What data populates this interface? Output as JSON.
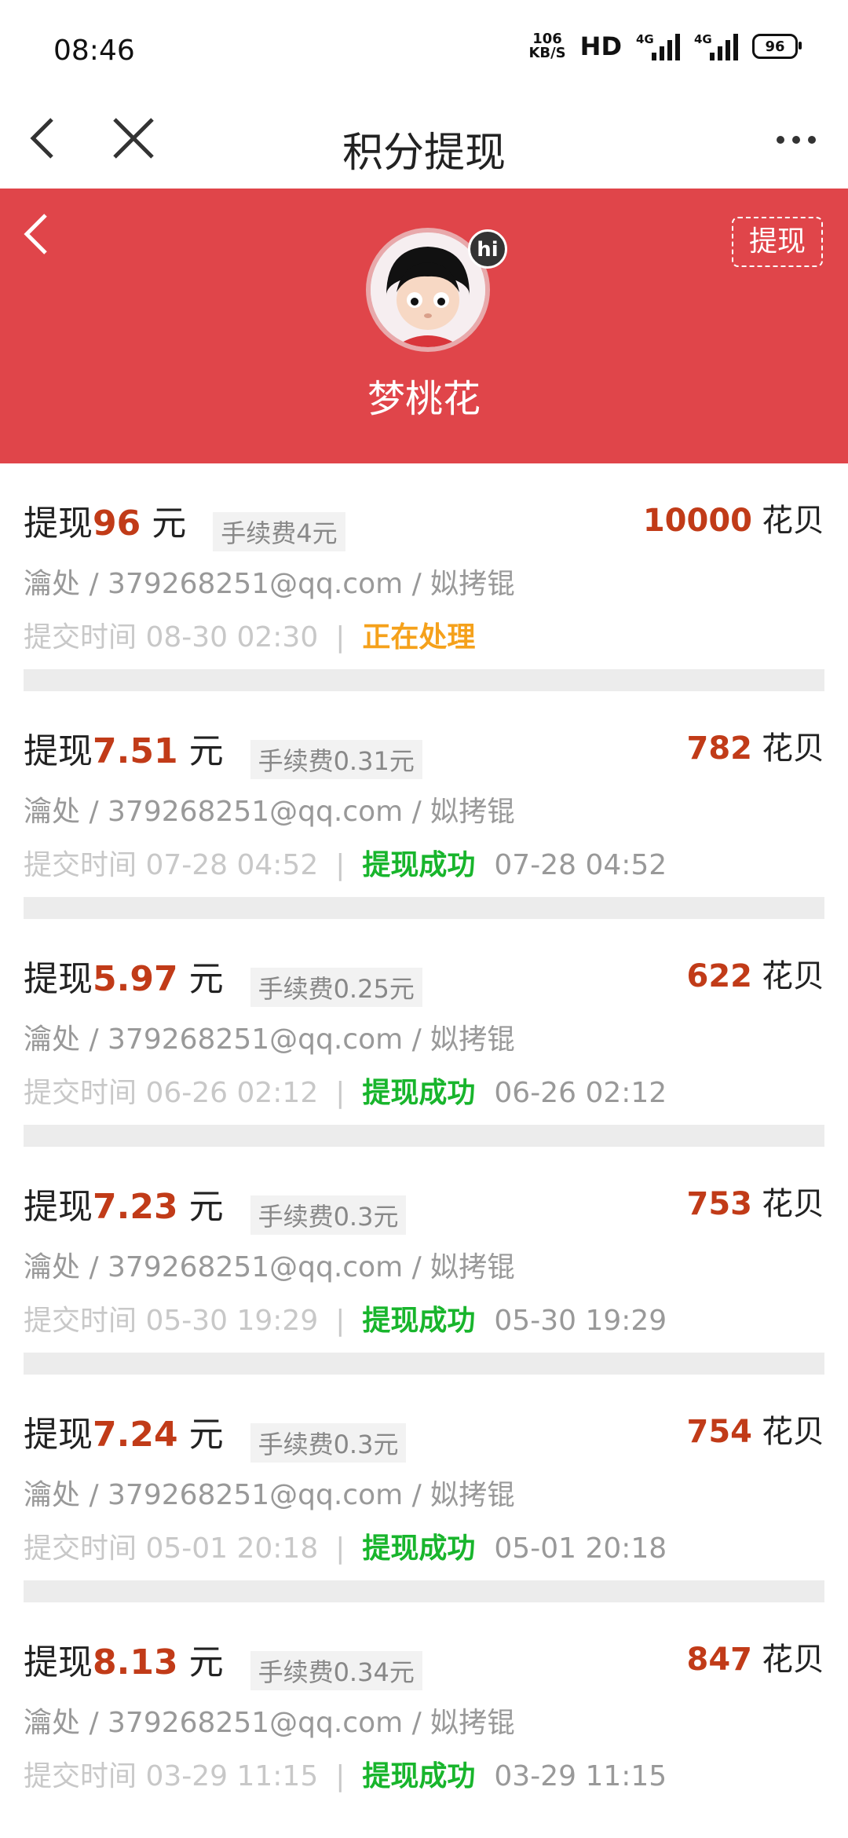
{
  "status_bar": {
    "time": "08:46",
    "net_speed_top": "106",
    "net_speed_bottom": "KB/S",
    "hd": "HD",
    "sim1": "4G",
    "sim2": "4G",
    "battery": "96"
  },
  "nav": {
    "title": "积分提现",
    "back_icon": "chevron-left-icon",
    "close_icon": "close-icon",
    "more_icon": "more-icon"
  },
  "profile": {
    "username": "梦桃花",
    "badge": "hi",
    "withdraw_label": "提现",
    "bg_color": "#e0454a"
  },
  "records": [
    {
      "prefix": "提现",
      "amount": "96",
      "unit": "元",
      "fee": "手续费4元",
      "points": "10000",
      "points_unit": "花贝",
      "account": "瀹处 / 379268251@qq.com / 姒拷锟",
      "time_label": "提交时间 08-30 02:30",
      "sep": "|",
      "status": "正在处理",
      "status_type": "pending",
      "done_time": ""
    },
    {
      "prefix": "提现",
      "amount": "7.51",
      "unit": "元",
      "fee": "手续费0.31元",
      "points": "782",
      "points_unit": "花贝",
      "account": "瀹处 / 379268251@qq.com / 姒拷锟",
      "time_label": "提交时间 07-28 04:52",
      "sep": "|",
      "status": "提现成功",
      "status_type": "ok",
      "done_time": "07-28 04:52"
    },
    {
      "prefix": "提现",
      "amount": "5.97",
      "unit": "元",
      "fee": "手续费0.25元",
      "points": "622",
      "points_unit": "花贝",
      "account": "瀹处 / 379268251@qq.com / 姒拷锟",
      "time_label": "提交时间 06-26 02:12",
      "sep": "|",
      "status": "提现成功",
      "status_type": "ok",
      "done_time": "06-26 02:12"
    },
    {
      "prefix": "提现",
      "amount": "7.23",
      "unit": "元",
      "fee": "手续费0.3元",
      "points": "753",
      "points_unit": "花贝",
      "account": "瀹处 / 379268251@qq.com / 姒拷锟",
      "time_label": "提交时间 05-30 19:29",
      "sep": "|",
      "status": "提现成功",
      "status_type": "ok",
      "done_time": "05-30 19:29"
    },
    {
      "prefix": "提现",
      "amount": "7.24",
      "unit": "元",
      "fee": "手续费0.3元",
      "points": "754",
      "points_unit": "花贝",
      "account": "瀹处 / 379268251@qq.com / 姒拷锟",
      "time_label": "提交时间 05-01 20:18",
      "sep": "|",
      "status": "提现成功",
      "status_type": "ok",
      "done_time": "05-01 20:18"
    },
    {
      "prefix": "提现",
      "amount": "8.13",
      "unit": "元",
      "fee": "手续费0.34元",
      "points": "847",
      "points_unit": "花贝",
      "account": "瀹处 / 379268251@qq.com / 姒拷锟",
      "time_label": "提交时间 03-29 11:15",
      "sep": "|",
      "status": "提现成功",
      "status_type": "ok",
      "done_time": "03-29 11:15"
    }
  ]
}
